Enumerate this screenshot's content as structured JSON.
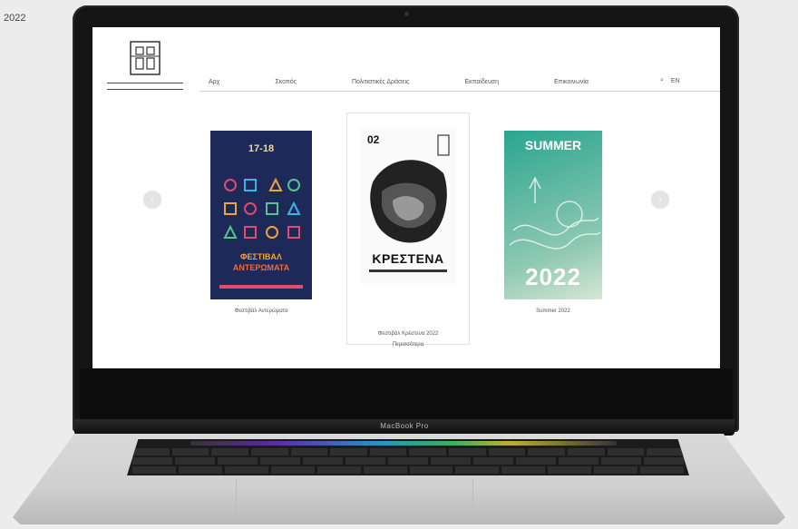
{
  "corner_text": "2022",
  "macbook_label": "MacBook Pro",
  "nav": {
    "items": [
      "Αρχ",
      "Σκοπός",
      "Πολιτιστικές Δράσεις",
      "Εκπαίδευση",
      "Επικοινωνία"
    ],
    "tools": [
      "⌕",
      "EN"
    ]
  },
  "slider": {
    "prev": "‹",
    "next": "›"
  },
  "posters": [
    {
      "date": "17-18",
      "title1": "ΦΕΣΤΙΒΑΛ",
      "title2": "ΑΝΤΕΡΩΜΑΤΑ",
      "caption": "Φεστιβάλ Αντερώματα"
    },
    {
      "num": "02",
      "title": "ΚΡΕΣΤΕΝΑ",
      "caption": "Φεστιβάλ Κρέστενα 2022",
      "caption2": "Περισσότερα"
    },
    {
      "top": "SUMMER",
      "year": "2022",
      "caption": "Summer 2022"
    }
  ]
}
